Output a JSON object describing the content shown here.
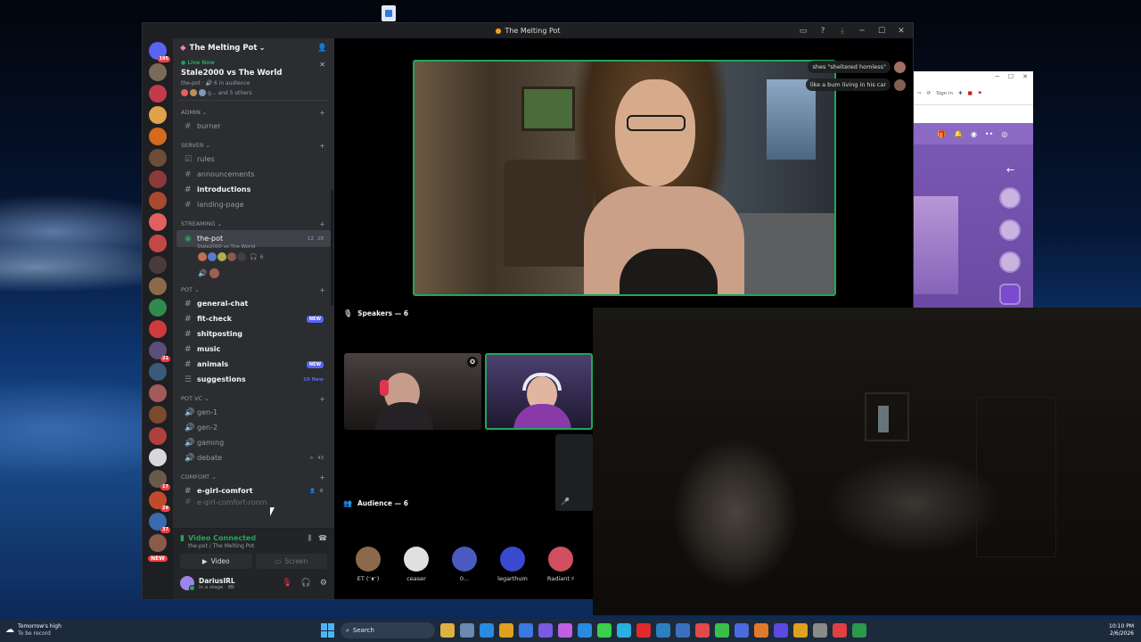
{
  "window": {
    "title": "The Melting Pot",
    "controls": [
      "▭",
      "?",
      "⤓",
      "─",
      "☐",
      "✕"
    ]
  },
  "servers": [
    {
      "color": "#5865f2",
      "badge": "195",
      "icon": "discord-logo-icon"
    },
    {
      "color": "#7a6a5a",
      "badge": ""
    },
    {
      "color": "#c23b4a",
      "badge": ""
    },
    {
      "color": "#e2a24a",
      "badge": ""
    },
    {
      "color": "#d46a1c",
      "badge": ""
    },
    {
      "color": "#6b4d3a",
      "badge": ""
    },
    {
      "color": "#8a3a3a",
      "badge": ""
    },
    {
      "color": "#a84a2e",
      "badge": ""
    },
    {
      "color": "#e06060",
      "badge": ""
    },
    {
      "color": "#c24848",
      "badge": ""
    },
    {
      "color": "#4a3a3a",
      "badge": ""
    },
    {
      "color": "#8a6a4a",
      "badge": ""
    },
    {
      "color": "#2e8a4e",
      "badge": ""
    },
    {
      "color": "#d03a3a",
      "badge": ""
    },
    {
      "color": "#5a4e7a",
      "badge": "21"
    },
    {
      "color": "#3a5a7a",
      "badge": ""
    },
    {
      "color": "#a45a5a",
      "badge": ""
    },
    {
      "color": "#7a4a2a",
      "badge": ""
    },
    {
      "color": "#b04040",
      "badge": ""
    },
    {
      "color": "#d8d8d8",
      "badge": ""
    },
    {
      "color": "#6a5a4a",
      "badge": "17"
    },
    {
      "color": "#c24a2a",
      "badge": "29"
    },
    {
      "color": "#3a6ab0",
      "badge": "37"
    },
    {
      "color": "#8a5a4a",
      "badge": ""
    }
  ],
  "servers_new_label": "NEW",
  "guild": {
    "name": "The Melting Pot",
    "chevron": "⌄"
  },
  "live": {
    "tag": "● Live Now",
    "title": "Stale2000 vs The World",
    "sub": "the-pot · 🔊 6 in audience",
    "attendees": "g... and 5 others",
    "attendee_colors": [
      "#e06060",
      "#c09050",
      "#7a9ac0"
    ]
  },
  "categories": {
    "admin": "ADMIN ⌄",
    "server": "server ⌄",
    "streaming": "streaming ⌄",
    "pot": "pot ⌄",
    "pot_vc": "pot vc ⌄",
    "comfort": "comfort ⌄"
  },
  "channels": {
    "burner": "burner",
    "rules": "rules",
    "announcements": "announcements",
    "introductions": "introductions",
    "landing_page": "landing-page",
    "the_pot": "the-pot",
    "the_pot_sub": "Stale2000 vs The World",
    "the_pot_counts": [
      "12",
      "28"
    ],
    "the_pot_extra": "6",
    "general_chat": "general-chat",
    "fit_check": "fit-check",
    "shitposting": "shitposting",
    "music": "music",
    "animals": "animals",
    "suggestions": "suggestions",
    "suggestions_badge": "10 New",
    "gen1": "gen-1",
    "gen2": "gen-2",
    "gaming": "gaming",
    "debate": "debate",
    "debate_badge": "43",
    "egirl": "e-girl-comfort",
    "egirl2": "e-girl-comfort-room",
    "new_badge": "NEW"
  },
  "voice_panel": {
    "status": "Video Connected",
    "location": "the-pot / The Melting Pot",
    "video_label": "Video",
    "screen_label": "Screen"
  },
  "user": {
    "name": "DariusIRL",
    "status": "In a stage · 🎟"
  },
  "stage": {
    "chat": [
      {
        "text": "shes \"sheltered homless\""
      },
      {
        "text": "like a bum living in his car"
      }
    ],
    "speakers_label": "Speakers — 6",
    "audience_label": "Audience — 6",
    "audience": [
      {
        "name": "ET (ᵔᴥᵔ)",
        "color": "#8a6a4a"
      },
      {
        "name": "ceaser",
        "color": "#e0e0e0"
      },
      {
        "name": "0...",
        "color": "#4a5ac0"
      },
      {
        "name": "legarthum",
        "color": "#3a4ad0"
      },
      {
        "name": "Radiant ♯",
        "color": "#d05060"
      }
    ]
  },
  "browser2": {
    "sign_in": "Sign in",
    "controls": [
      "─",
      "☐",
      "✕"
    ]
  },
  "taskbar": {
    "weather_title": "Tomorrow's high",
    "weather_sub": "To be record",
    "search": "Search",
    "time": "10:10 PM",
    "date": "2/6/2026",
    "app_colors": [
      "#e0b040",
      "#6a8ab0",
      "#2a8ae0",
      "#e0a020",
      "#3a7ae0",
      "#7a5ae0",
      "#c060e0",
      "#2a8ae0",
      "#3ad04a",
      "#2ab0e0",
      "#e02a2a",
      "#2a80c0",
      "#3a70c0",
      "#e04a4a",
      "#3ac04a",
      "#4a6ae0",
      "#e07a2a",
      "#5a4ae0",
      "#e0a020",
      "#8a8a8a",
      "#e04040",
      "#2a9a4a"
    ]
  }
}
